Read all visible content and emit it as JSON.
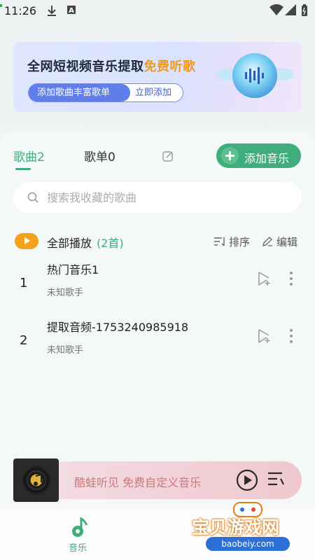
{
  "status": {
    "time": "11:26",
    "icons": [
      "download-icon",
      "a-notification-icon",
      "wifi-icon",
      "signal-icon",
      "battery-icon"
    ]
  },
  "banner": {
    "title_main": "全网短视频音乐提取",
    "title_highlight": "免费听歌",
    "pill_left": "添加歌曲丰富歌单",
    "pill_right": "立即添加"
  },
  "tabs": [
    {
      "label": "歌曲2",
      "active": true
    },
    {
      "label": "歌单0",
      "active": false
    }
  ],
  "add_music": {
    "label": "添加音乐"
  },
  "search": {
    "placeholder": "搜索我收藏的歌曲",
    "value": ""
  },
  "playall": {
    "label": "全部播放",
    "count": "(2首)"
  },
  "sort": {
    "label": "排序"
  },
  "edit": {
    "label": "编辑"
  },
  "songs": [
    {
      "index": "1",
      "title": "热门音乐1",
      "artist": "未知歌手"
    },
    {
      "index": "2",
      "title": "提取音频-1753240985918",
      "artist": "未知歌手"
    }
  ],
  "player": {
    "text": "酷蛙听见 免费自定义音乐"
  },
  "nav": {
    "music_label": "音乐"
  },
  "watermark": {
    "title": "宝贝游戏网",
    "url": "baobeiy.com"
  },
  "colors": {
    "accent": "#3fae7c",
    "orange": "#f2a31b",
    "banner_blue": "#5f7ee9"
  }
}
